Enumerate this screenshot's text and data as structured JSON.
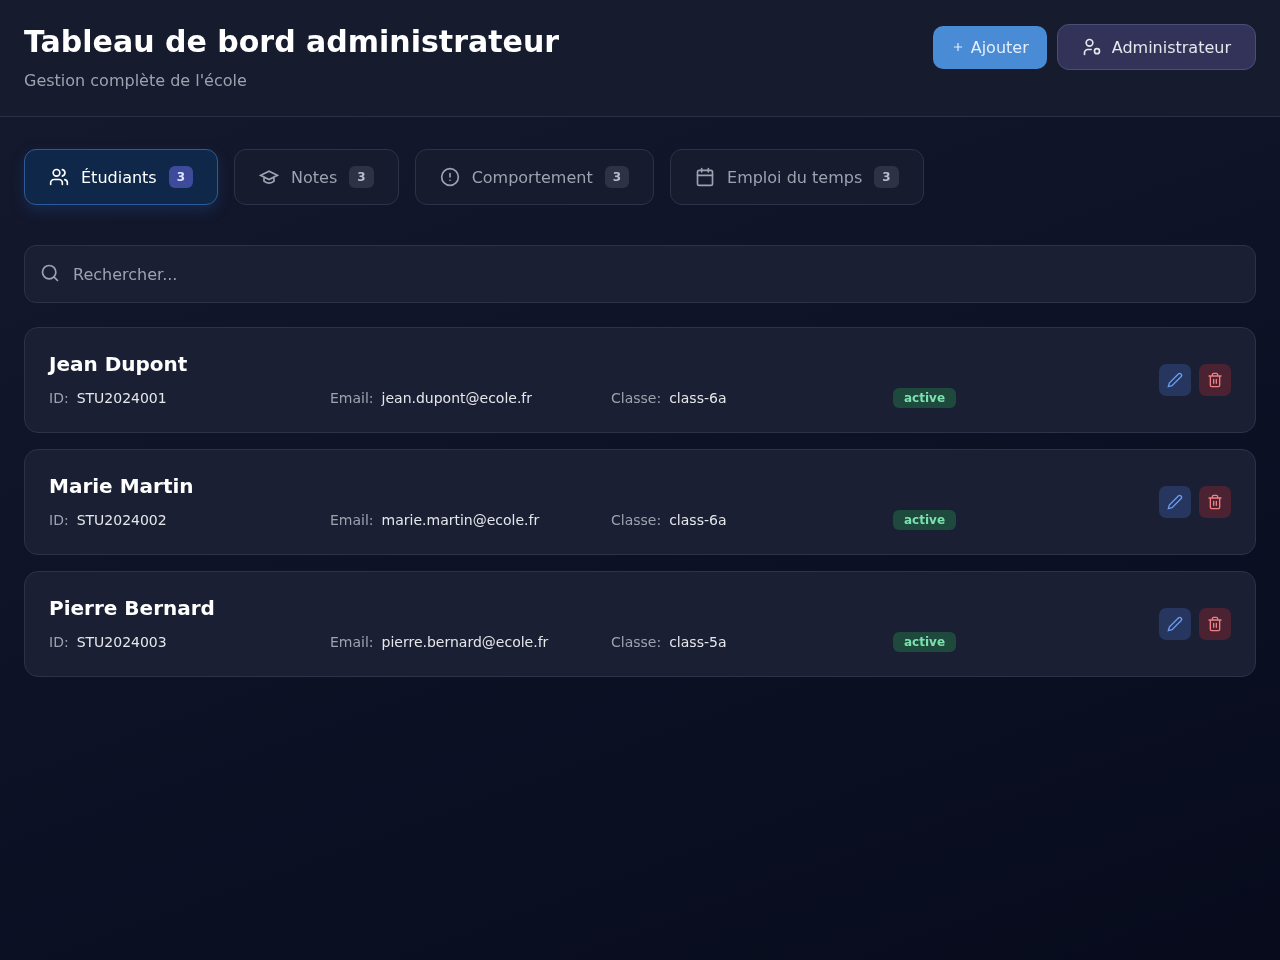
{
  "header": {
    "title": "Tableau de bord administrateur",
    "subtitle": "Gestion complète de l'école",
    "role": "Administrateur",
    "add_button": "Ajouter"
  },
  "tabs": [
    {
      "label": "Étudiants",
      "count": "3",
      "kind": "users",
      "selected": true
    },
    {
      "label": "Notes",
      "count": "3",
      "kind": "cap",
      "selected": false
    },
    {
      "label": "Comportement",
      "count": "3",
      "kind": "alert",
      "selected": false
    },
    {
      "label": "Emploi du temps",
      "count": "3",
      "kind": "calendar",
      "selected": false
    }
  ],
  "search": {
    "placeholder": "Rechercher..."
  },
  "students": [
    {
      "name": "Jean Dupont",
      "id_label": "ID:",
      "id": "STU2024001",
      "email_label": "Email:",
      "email": "jean.dupont@ecole.fr",
      "class_label": "Classe:",
      "class": "class-6a",
      "status": "active"
    },
    {
      "name": "Marie Martin",
      "id_label": "ID:",
      "id": "STU2024002",
      "email_label": "Email:",
      "email": "marie.martin@ecole.fr",
      "class_label": "Classe:",
      "class": "class-6a",
      "status": "active"
    },
    {
      "name": "Pierre Bernard",
      "id_label": "ID:",
      "id": "STU2024003",
      "email_label": "Email:",
      "email": "pierre.bernard@ecole.fr",
      "class_label": "Classe:",
      "class": "class-5a",
      "status": "active"
    }
  ]
}
